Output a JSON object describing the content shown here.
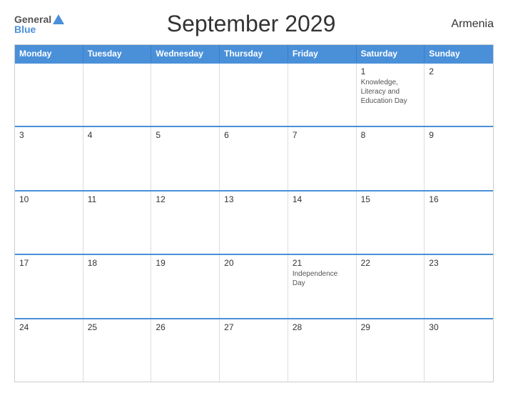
{
  "header": {
    "logo_general": "General",
    "logo_blue": "Blue",
    "title": "September 2029",
    "country": "Armenia"
  },
  "days_of_week": [
    "Monday",
    "Tuesday",
    "Wednesday",
    "Thursday",
    "Friday",
    "Saturday",
    "Sunday"
  ],
  "weeks": [
    [
      {
        "day": "",
        "holiday": ""
      },
      {
        "day": "",
        "holiday": ""
      },
      {
        "day": "",
        "holiday": ""
      },
      {
        "day": "",
        "holiday": ""
      },
      {
        "day": "",
        "holiday": ""
      },
      {
        "day": "1",
        "holiday": "Knowledge, Literacy and Education Day"
      },
      {
        "day": "2",
        "holiday": ""
      }
    ],
    [
      {
        "day": "3",
        "holiday": ""
      },
      {
        "day": "4",
        "holiday": ""
      },
      {
        "day": "5",
        "holiday": ""
      },
      {
        "day": "6",
        "holiday": ""
      },
      {
        "day": "7",
        "holiday": ""
      },
      {
        "day": "8",
        "holiday": ""
      },
      {
        "day": "9",
        "holiday": ""
      }
    ],
    [
      {
        "day": "10",
        "holiday": ""
      },
      {
        "day": "11",
        "holiday": ""
      },
      {
        "day": "12",
        "holiday": ""
      },
      {
        "day": "13",
        "holiday": ""
      },
      {
        "day": "14",
        "holiday": ""
      },
      {
        "day": "15",
        "holiday": ""
      },
      {
        "day": "16",
        "holiday": ""
      }
    ],
    [
      {
        "day": "17",
        "holiday": ""
      },
      {
        "day": "18",
        "holiday": ""
      },
      {
        "day": "19",
        "holiday": ""
      },
      {
        "day": "20",
        "holiday": ""
      },
      {
        "day": "21",
        "holiday": "Independence Day"
      },
      {
        "day": "22",
        "holiday": ""
      },
      {
        "day": "23",
        "holiday": ""
      }
    ],
    [
      {
        "day": "24",
        "holiday": ""
      },
      {
        "day": "25",
        "holiday": ""
      },
      {
        "day": "26",
        "holiday": ""
      },
      {
        "day": "27",
        "holiday": ""
      },
      {
        "day": "28",
        "holiday": ""
      },
      {
        "day": "29",
        "holiday": ""
      },
      {
        "day": "30",
        "holiday": ""
      }
    ]
  ]
}
